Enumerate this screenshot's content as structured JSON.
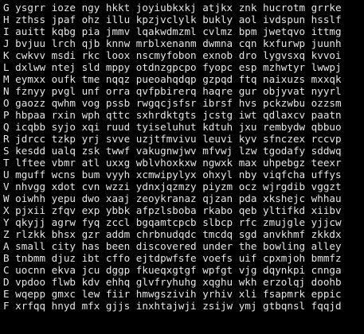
{
  "terminal": {
    "colors": {
      "background": "#000000",
      "foreground": "#e6e6e6"
    },
    "rows": [
      "G ysgrr ioze ngy hkkt joyiubkxkj atjkx znk hucrotm grrke",
      "H zthss jpaf ohz illu kpzjvclylk bukly aol ivdspun hsslf",
      "I auitt kqbg pia jmmv lqakwdmzml cvlmz bpm jwetqvo ittmg",
      "J bvjuu lrch qjb knnw mrblxenanm dwmna cqn kxfurwp juunh",
      "K cwkvv msdi rkc loox nscmyfobon exnob dro lygvsxq kvvoi",
      "L dxlww ntej sld mppy otdnzgpcpo fyopc esp mzhwtyr lwwpj",
      "M eymxx oufk tme nqqz pueoahqdqp gzpqd ftq naixuzs mxxqk",
      "N fznyy pvgl unf orra qvfpbirerq haqre gur objyvat nyyrl",
      "O gaozz qwhm vog pssb rwgqcjsfsr ibrsf hvs pckzwbu ozzsm",
      "P hbpaa rxin wph qttc sxhrdktgts jcstg iwt qdlaxcv paatn",
      "Q icqbb syjo xqi ruud tyiseluhut kdtuh jxu rembydw qbbuo",
      "R jdrcc tzkp yrj svve uzjtfmvivu leuvi kyv sfnczex rccvp",
      "S kesdd ualq zsk twwf vakugnwjwv mfvwj lzw tgodafy sddwq",
      "T lftee vbmr atl uxxg wblvhoxkxw ngwxk max uhpebgz teexr",
      "U mguff wcns bum vyyh xcmwipylyx ohxyl nby viqfcha uffys",
      "V nhvgg xdot cvn wzzi ydnxjqzmzy piyzm ocz wjrgdib vggzt",
      "W oiwhh yepu dwo xaaj zeoykranaz qjzan pda xkshejc whhau",
      "X pjxii zfqv exp ybbk afpzlsboba rkabo qeb yltifkd xiibv",
      "Y qkyjj agrw fyq zccl bgqamtcpcb slbcp rfc zmujgle yjjcw",
      "Z rlzkk bhsx gzr addm chrbnudqdc tmcdq sgd anvkhmf zkkdx",
      "A small city has been discovered under the bowling alley",
      "B tnbmm djuz ibt cffo ejtdpwfsfe voefs uif cpxmjoh bmmfz",
      "C uocnn ekva jcu dggp fkueqxgtgf wpfgt vjg dqynkpi cnnga",
      "D vpdoo flwb kdv ehhq glvfryhuhg xqghu wkh erzolqj doohb",
      "E wqepp gmxc lew fiir hmwgszivih yrhiv xli fsapmrk eppic",
      "F xrfqq hnyd mfx gjjs inxhtajwji zsijw ymj gtbqnsl fqqjd"
    ]
  }
}
